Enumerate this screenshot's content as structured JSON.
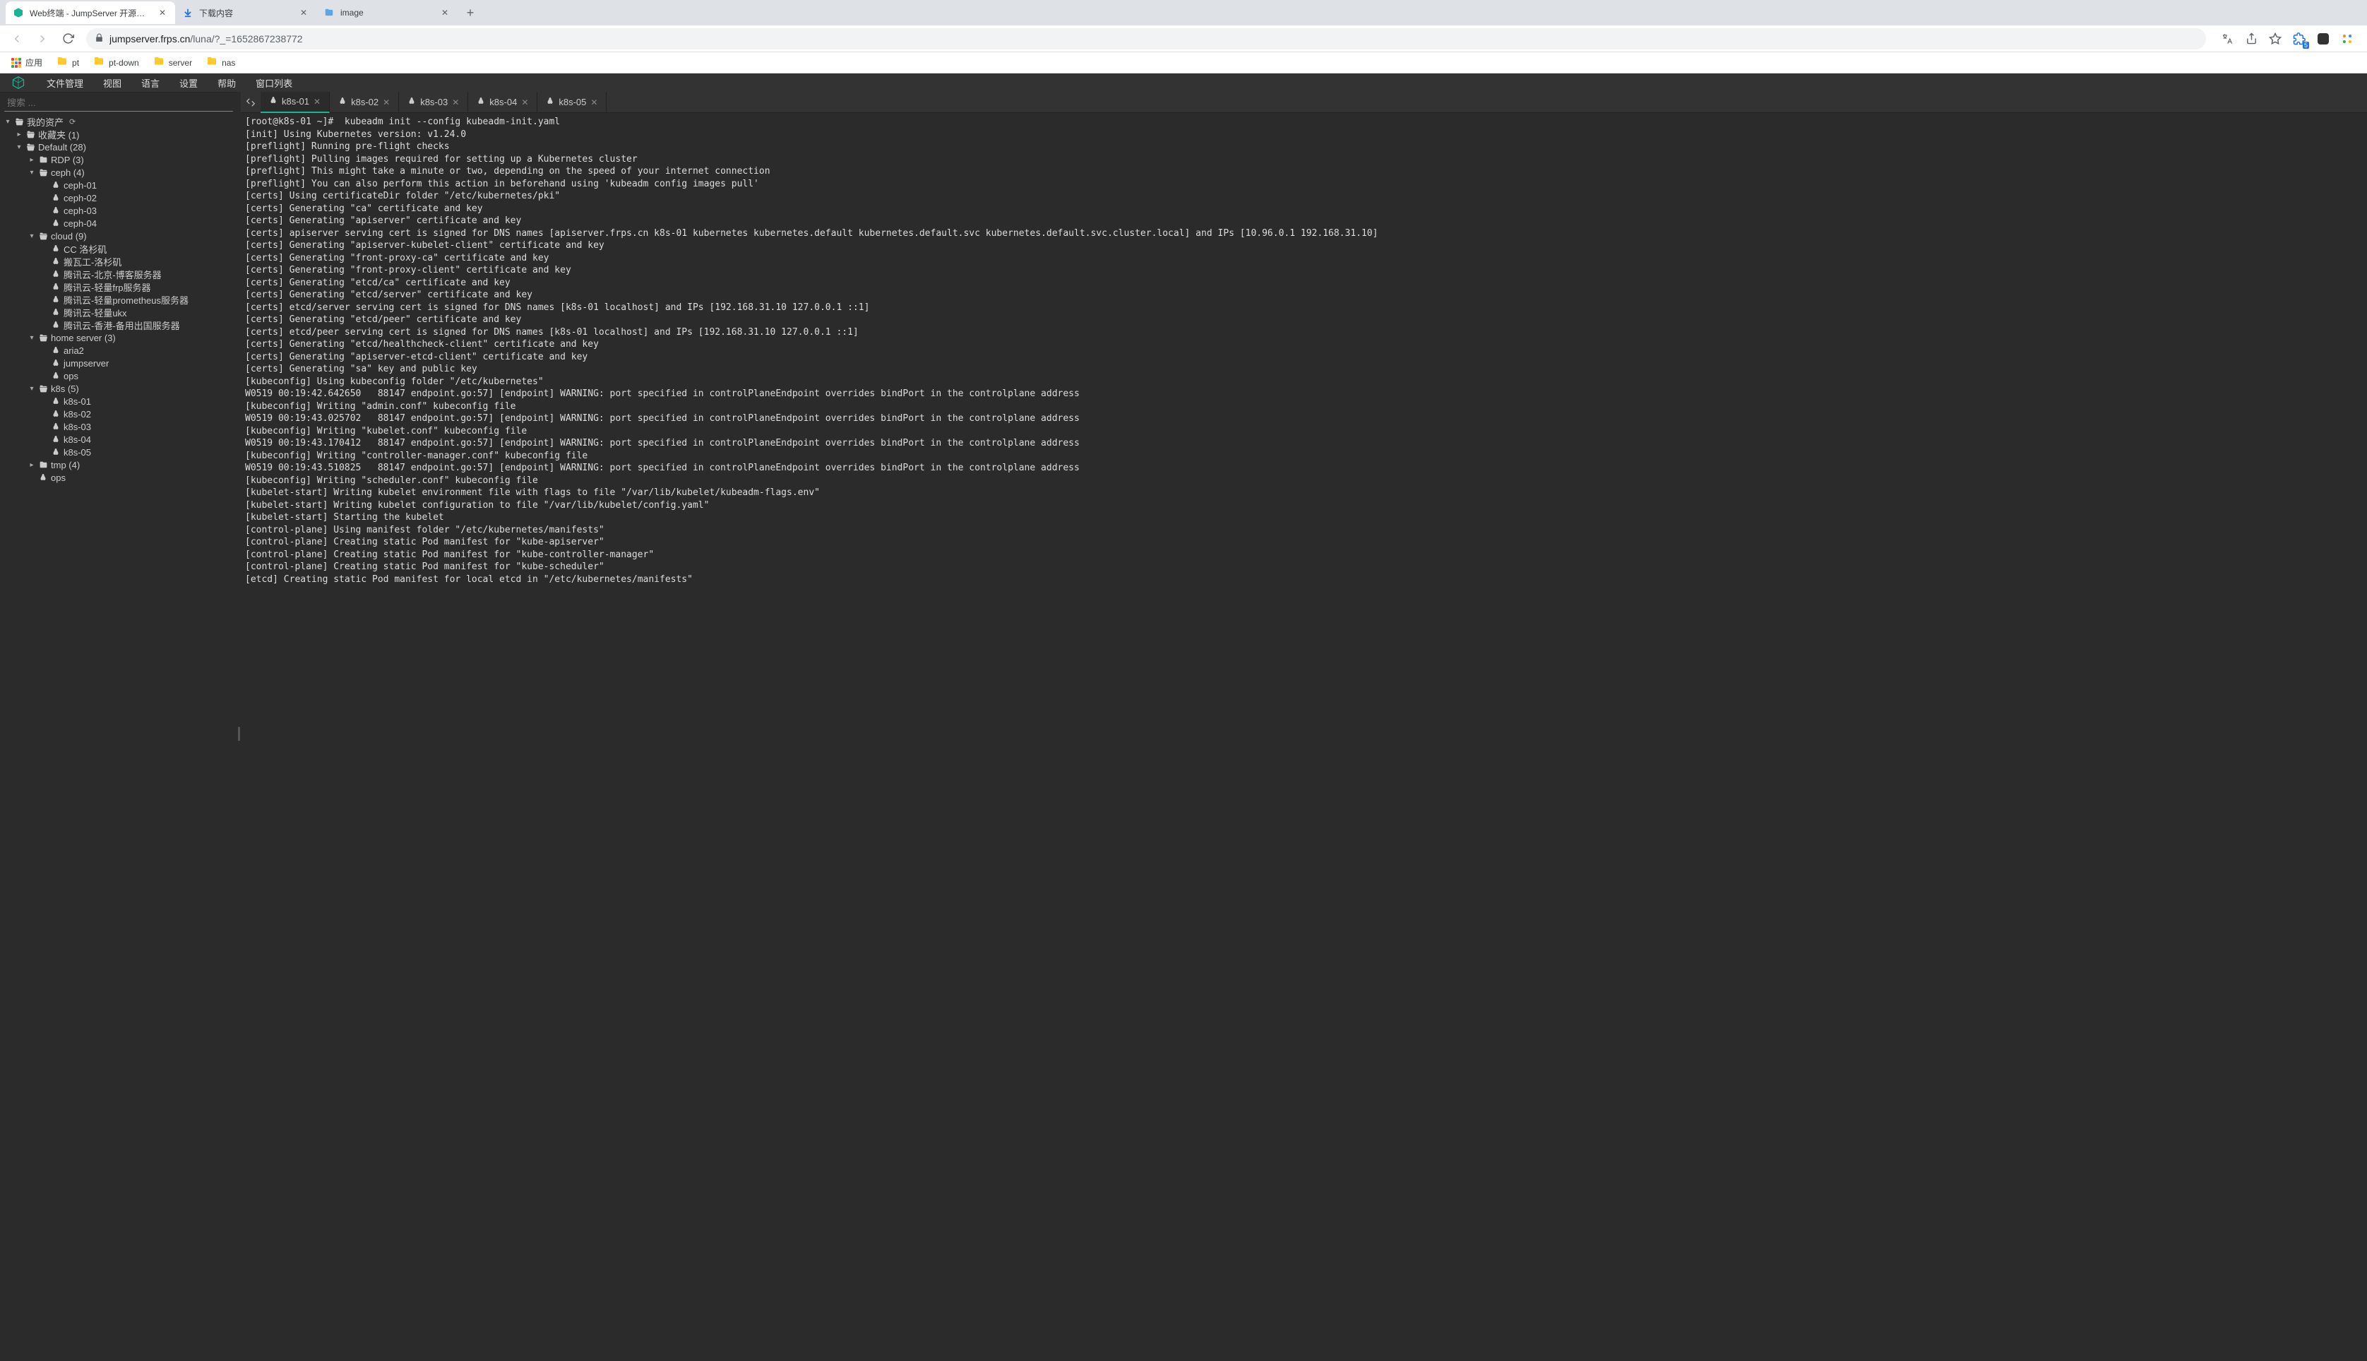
{
  "browser": {
    "tabs": [
      {
        "title": "Web终端 - JumpServer 开源堡...",
        "active": true,
        "favcolor": "#1ab394"
      },
      {
        "title": "下载内容",
        "active": false,
        "favcolor": "#1a73e8"
      },
      {
        "title": "image",
        "active": false,
        "favcolor": "#1a73e8"
      }
    ],
    "url_host": "jumpserver.frps.cn",
    "url_path": "/luna/?_=1652867238772",
    "bookmarks": [
      {
        "label": "应用",
        "type": "apps"
      },
      {
        "label": "pt",
        "type": "folder"
      },
      {
        "label": "pt-down",
        "type": "folder"
      },
      {
        "label": "server",
        "type": "folder"
      },
      {
        "label": "nas",
        "type": "folder"
      }
    ],
    "ext_badge": "5"
  },
  "app": {
    "menu": [
      "文件管理",
      "视图",
      "语言",
      "设置",
      "帮助",
      "窗口列表"
    ],
    "search_placeholder": "搜索 ...",
    "tree": [
      {
        "ind": 0,
        "caret": "▾",
        "ico": "📂",
        "label": "我的资产",
        "refresh": true
      },
      {
        "ind": 1,
        "caret": "▸",
        "ico": "📂",
        "label": "收藏夹 (1)"
      },
      {
        "ind": 1,
        "caret": "▾",
        "ico": "📂",
        "label": "Default (28)"
      },
      {
        "ind": 2,
        "caret": "▸",
        "ico": "📁",
        "label": "RDP (3)"
      },
      {
        "ind": 2,
        "caret": "▾",
        "ico": "📂",
        "label": "ceph (4)"
      },
      {
        "ind": 3,
        "caret": "",
        "ico": "🐧",
        "label": "ceph-01"
      },
      {
        "ind": 3,
        "caret": "",
        "ico": "🐧",
        "label": "ceph-02"
      },
      {
        "ind": 3,
        "caret": "",
        "ico": "🐧",
        "label": "ceph-03"
      },
      {
        "ind": 3,
        "caret": "",
        "ico": "🐧",
        "label": "ceph-04"
      },
      {
        "ind": 2,
        "caret": "▾",
        "ico": "📂",
        "label": "cloud (9)"
      },
      {
        "ind": 3,
        "caret": "",
        "ico": "🐧",
        "label": "CC 洛杉矶"
      },
      {
        "ind": 3,
        "caret": "",
        "ico": "🐧",
        "label": "搬瓦工-洛杉矶"
      },
      {
        "ind": 3,
        "caret": "",
        "ico": "🐧",
        "label": "腾讯云-北京-博客服务器"
      },
      {
        "ind": 3,
        "caret": "",
        "ico": "🐧",
        "label": "腾讯云-轻量frp服务器"
      },
      {
        "ind": 3,
        "caret": "",
        "ico": "🐧",
        "label": "腾讯云-轻量prometheus服务器"
      },
      {
        "ind": 3,
        "caret": "",
        "ico": "🐧",
        "label": "腾讯云-轻量ukx"
      },
      {
        "ind": 3,
        "caret": "",
        "ico": "🐧",
        "label": "腾讯云-香港-备用出国服务器"
      },
      {
        "ind": 2,
        "caret": "▾",
        "ico": "📂",
        "label": "home server (3)"
      },
      {
        "ind": 3,
        "caret": "",
        "ico": "🐧",
        "label": "aria2"
      },
      {
        "ind": 3,
        "caret": "",
        "ico": "🐧",
        "label": "jumpserver"
      },
      {
        "ind": 3,
        "caret": "",
        "ico": "🐧",
        "label": "ops"
      },
      {
        "ind": 2,
        "caret": "▾",
        "ico": "📂",
        "label": "k8s (5)"
      },
      {
        "ind": 3,
        "caret": "",
        "ico": "🐧",
        "label": "k8s-01"
      },
      {
        "ind": 3,
        "caret": "",
        "ico": "🐧",
        "label": "k8s-02"
      },
      {
        "ind": 3,
        "caret": "",
        "ico": "🐧",
        "label": "k8s-03"
      },
      {
        "ind": 3,
        "caret": "",
        "ico": "🐧",
        "label": "k8s-04"
      },
      {
        "ind": 3,
        "caret": "",
        "ico": "🐧",
        "label": "k8s-05"
      },
      {
        "ind": 2,
        "caret": "▸",
        "ico": "📁",
        "label": "tmp (4)"
      },
      {
        "ind": 2,
        "caret": "",
        "ico": "🐧",
        "label": "ops"
      }
    ],
    "term_tabs": [
      {
        "name": "k8s-01",
        "active": true
      },
      {
        "name": "k8s-02",
        "active": false
      },
      {
        "name": "k8s-03",
        "active": false
      },
      {
        "name": "k8s-04",
        "active": false
      },
      {
        "name": "k8s-05",
        "active": false
      }
    ],
    "terminal_lines": [
      "[root@k8s-01 ~]#  kubeadm init --config kubeadm-init.yaml",
      "[init] Using Kubernetes version: v1.24.0",
      "[preflight] Running pre-flight checks",
      "[preflight] Pulling images required for setting up a Kubernetes cluster",
      "[preflight] This might take a minute or two, depending on the speed of your internet connection",
      "[preflight] You can also perform this action in beforehand using 'kubeadm config images pull'",
      "[certs] Using certificateDir folder \"/etc/kubernetes/pki\"",
      "[certs] Generating \"ca\" certificate and key",
      "[certs] Generating \"apiserver\" certificate and key",
      "[certs] apiserver serving cert is signed for DNS names [apiserver.frps.cn k8s-01 kubernetes kubernetes.default kubernetes.default.svc kubernetes.default.svc.cluster.local] and IPs [10.96.0.1 192.168.31.10]",
      "[certs] Generating \"apiserver-kubelet-client\" certificate and key",
      "[certs] Generating \"front-proxy-ca\" certificate and key",
      "[certs] Generating \"front-proxy-client\" certificate and key",
      "[certs] Generating \"etcd/ca\" certificate and key",
      "[certs] Generating \"etcd/server\" certificate and key",
      "[certs] etcd/server serving cert is signed for DNS names [k8s-01 localhost] and IPs [192.168.31.10 127.0.0.1 ::1]",
      "[certs] Generating \"etcd/peer\" certificate and key",
      "[certs] etcd/peer serving cert is signed for DNS names [k8s-01 localhost] and IPs [192.168.31.10 127.0.0.1 ::1]",
      "[certs] Generating \"etcd/healthcheck-client\" certificate and key",
      "[certs] Generating \"apiserver-etcd-client\" certificate and key",
      "[certs] Generating \"sa\" key and public key",
      "[kubeconfig] Using kubeconfig folder \"/etc/kubernetes\"",
      "W0519 00:19:42.642650   88147 endpoint.go:57] [endpoint] WARNING: port specified in controlPlaneEndpoint overrides bindPort in the controlplane address",
      "[kubeconfig] Writing \"admin.conf\" kubeconfig file",
      "W0519 00:19:43.025702   88147 endpoint.go:57] [endpoint] WARNING: port specified in controlPlaneEndpoint overrides bindPort in the controlplane address",
      "[kubeconfig] Writing \"kubelet.conf\" kubeconfig file",
      "W0519 00:19:43.170412   88147 endpoint.go:57] [endpoint] WARNING: port specified in controlPlaneEndpoint overrides bindPort in the controlplane address",
      "[kubeconfig] Writing \"controller-manager.conf\" kubeconfig file",
      "W0519 00:19:43.510825   88147 endpoint.go:57] [endpoint] WARNING: port specified in controlPlaneEndpoint overrides bindPort in the controlplane address",
      "[kubeconfig] Writing \"scheduler.conf\" kubeconfig file",
      "[kubelet-start] Writing kubelet environment file with flags to file \"/var/lib/kubelet/kubeadm-flags.env\"",
      "[kubelet-start] Writing kubelet configuration to file \"/var/lib/kubelet/config.yaml\"",
      "[kubelet-start] Starting the kubelet",
      "[control-plane] Using manifest folder \"/etc/kubernetes/manifests\"",
      "[control-plane] Creating static Pod manifest for \"kube-apiserver\"",
      "[control-plane] Creating static Pod manifest for \"kube-controller-manager\"",
      "[control-plane] Creating static Pod manifest for \"kube-scheduler\"",
      "[etcd] Creating static Pod manifest for local etcd in \"/etc/kubernetes/manifests\""
    ]
  }
}
